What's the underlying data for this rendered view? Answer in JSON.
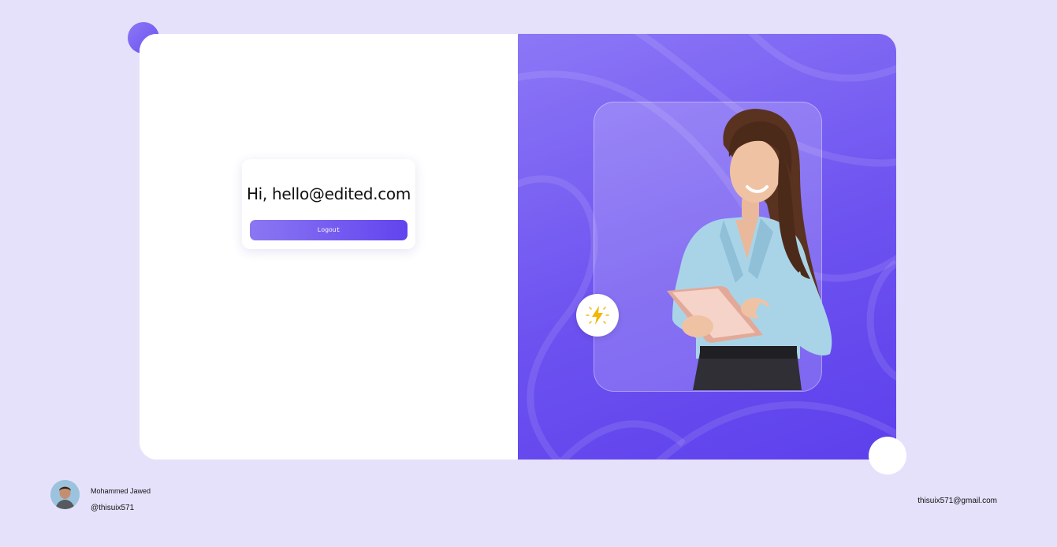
{
  "welcome": {
    "greeting": "Hi, hello@edited.com",
    "logout_label": "Logout"
  },
  "hero": {
    "badge_icon": "lightning-bolt-icon",
    "image": "woman-with-tablet"
  },
  "footer": {
    "name": "Mohammed Jawed",
    "handle": "@thisuix571",
    "email": "thisuix571@gmail.com",
    "avatar": "author-avatar"
  },
  "colors": {
    "page_background": "#e6e1fb",
    "accent_start": "#8b77f3",
    "accent_end": "#6244ee",
    "bolt": "#f2b705"
  }
}
